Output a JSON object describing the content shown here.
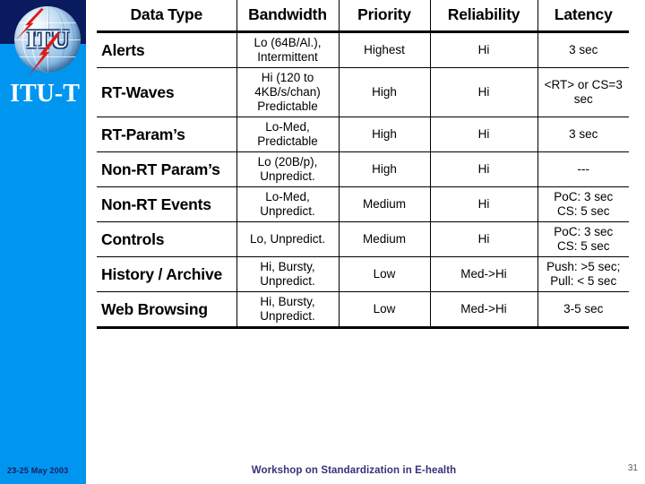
{
  "sidebar": {
    "logo_text": "ITU",
    "logo_icon": "itu-globe-lightning-logo",
    "brand": "ITU-T",
    "date": "23-25 May 2003",
    "navy_color": "#0a1a5e",
    "blue_color": "#0096f0"
  },
  "footer": {
    "title": "Workshop on Standardization in E-health",
    "title_color": "#33337a",
    "page_number": "31"
  },
  "table": {
    "headers": [
      "Data Type",
      "Bandwidth",
      "Priority",
      "Reliability",
      "Latency"
    ],
    "rows": [
      {
        "data_type": "Alerts",
        "bandwidth": "Lo (64B/Al.), Intermittent",
        "priority": "Highest",
        "reliability": "Hi",
        "latency": "3 sec"
      },
      {
        "data_type": "RT-Waves",
        "bandwidth": "Hi (120 to 4KB/s/chan) Predictable",
        "priority": "High",
        "reliability": "Hi",
        "latency": "<RT> or CS=3 sec"
      },
      {
        "data_type": "RT-Param’s",
        "bandwidth": "Lo-Med, Predictable",
        "priority": "High",
        "reliability": "Hi",
        "latency": "3 sec"
      },
      {
        "data_type": "Non-RT Param’s",
        "bandwidth": "Lo (20B/p), Unpredict.",
        "priority": "High",
        "reliability": "Hi",
        "latency": "---"
      },
      {
        "data_type": "Non-RT Events",
        "bandwidth": "Lo-Med, Unpredict.",
        "priority": "Medium",
        "reliability": "Hi",
        "latency": "PoC: 3 sec CS: 5 sec"
      },
      {
        "data_type": "Controls",
        "bandwidth": "Lo, Unpredict.",
        "priority": "Medium",
        "reliability": "Hi",
        "latency": "PoC: 3 sec CS: 5 sec"
      },
      {
        "data_type": "History / Archive",
        "bandwidth": "Hi, Bursty, Unpredict.",
        "priority": "Low",
        "reliability": "Med->Hi",
        "latency": "Push: >5 sec; Pull: < 5 sec"
      },
      {
        "data_type": "Web Browsing",
        "bandwidth": "Hi, Bursty, Unpredict.",
        "priority": "Low",
        "reliability": "Med->Hi",
        "latency": "3-5 sec"
      }
    ]
  }
}
